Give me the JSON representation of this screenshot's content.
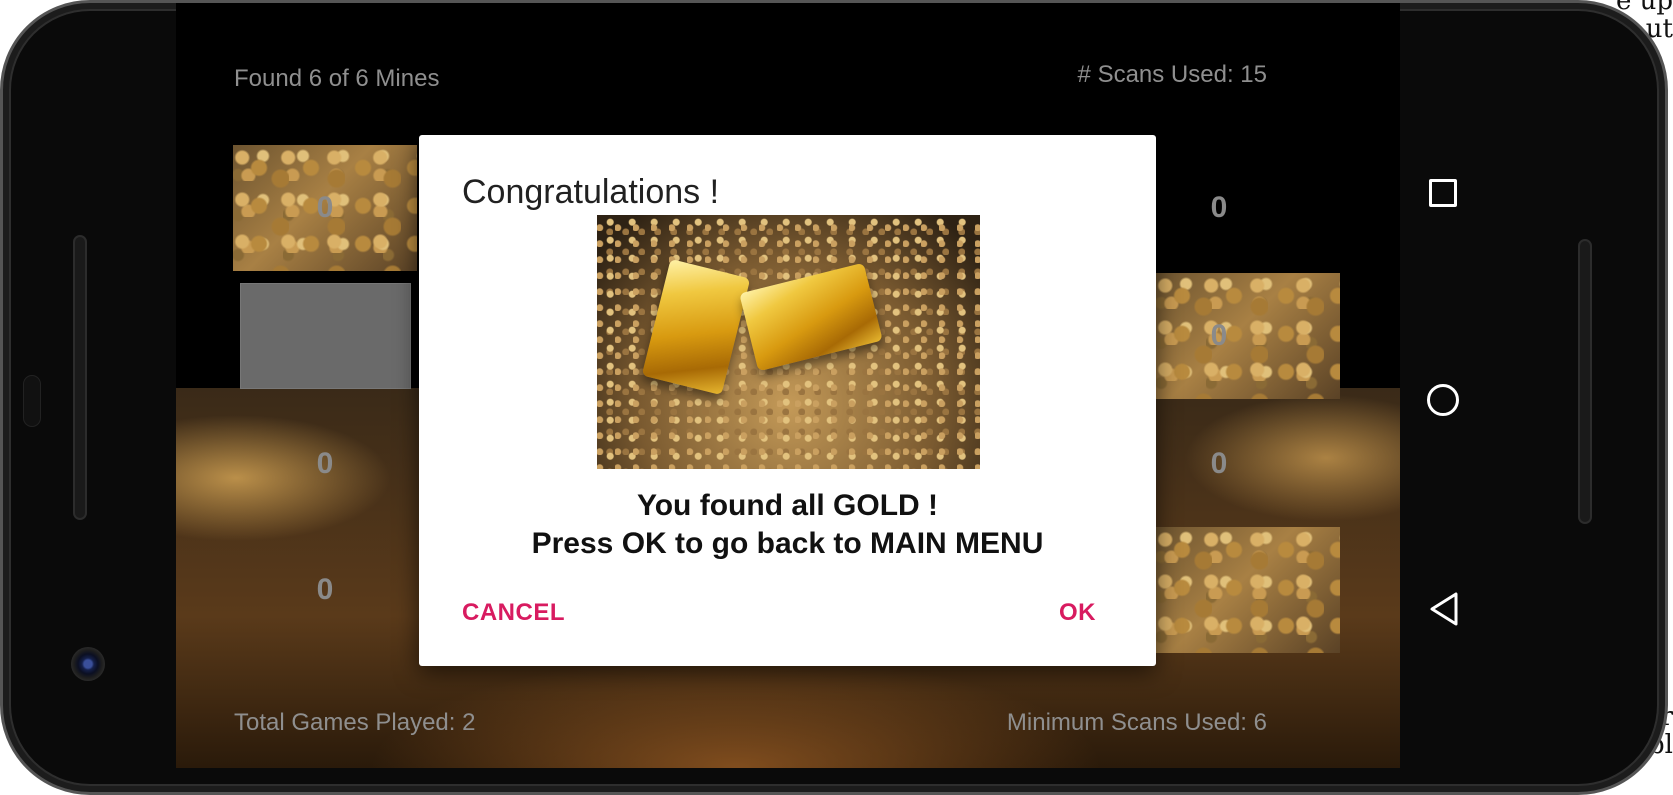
{
  "header": {
    "found_mines": "Found 6 of 6 Mines",
    "scans_used": "# Scans Used: 15"
  },
  "footer": {
    "total_games": "Total Games Played: 2",
    "min_scans": "Minimum Scans Used: 6"
  },
  "grid": {
    "visible_numbers": [
      "0",
      "0",
      "0",
      "0",
      "0",
      "0",
      "0"
    ]
  },
  "dialog": {
    "title": "Congratulations !",
    "message_line1": "You found all GOLD !",
    "message_line2": "Press OK to go back to MAIN MENU",
    "cancel_label": "CANCEL",
    "ok_label": "OK",
    "image_name": "gold-bars-image"
  },
  "nav": {
    "icons": [
      "recents-square-icon",
      "home-circle-icon",
      "back-triangle-icon"
    ]
  },
  "colors": {
    "accent": "#d81b60",
    "hud_text": "#8f8f8f",
    "screen_bg": "#000000"
  }
}
